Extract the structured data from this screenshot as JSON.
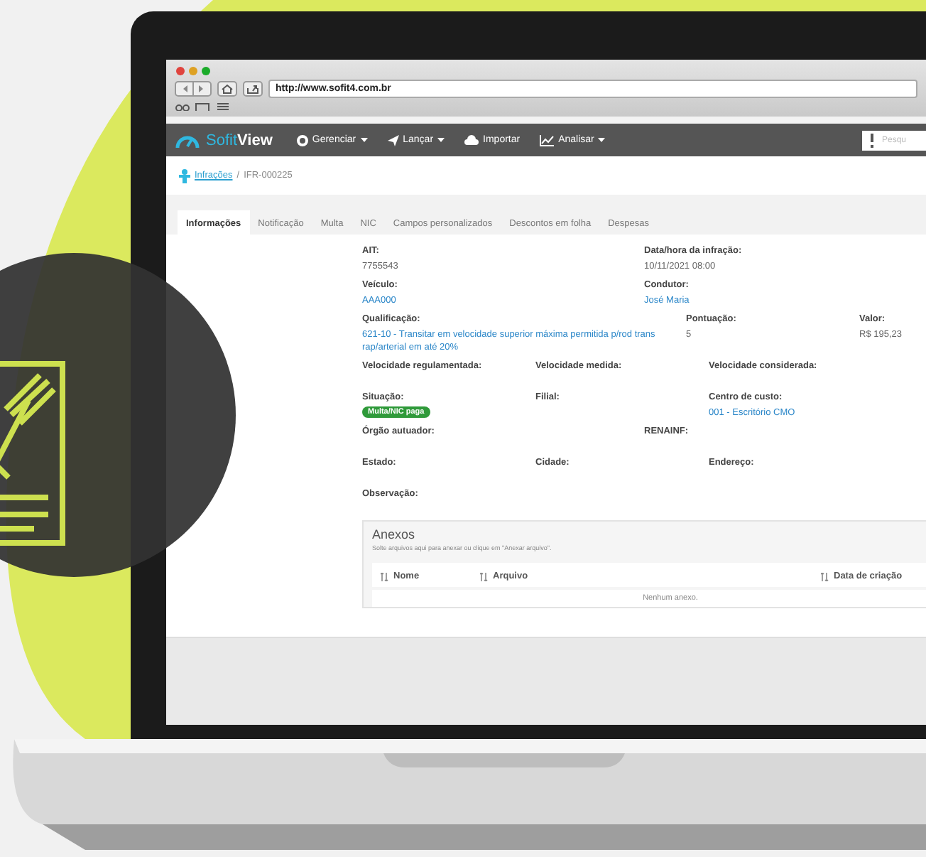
{
  "browser": {
    "url": "http://www.sofit4.com.br"
  },
  "navbar": {
    "logo": {
      "first": "Sofit",
      "second": "View"
    },
    "menu": [
      {
        "label": "Gerenciar",
        "kind": "gear",
        "dropdown": true
      },
      {
        "label": "Lançar",
        "kind": "plane",
        "dropdown": true
      },
      {
        "label": "Importar",
        "kind": "cloud",
        "dropdown": false
      },
      {
        "label": "Analisar",
        "kind": "chart",
        "dropdown": true
      }
    ],
    "search": {
      "placeholder": "Pesqu"
    }
  },
  "breadcrumb": {
    "link": "Infrações",
    "separator": "/",
    "current": "IFR-000225"
  },
  "tabs": [
    {
      "label": "Informações",
      "selected": true
    },
    {
      "label": "Notificação",
      "selected": false
    },
    {
      "label": "Multa",
      "selected": false
    },
    {
      "label": "NIC",
      "selected": false
    },
    {
      "label": "Campos personalizados",
      "selected": false
    },
    {
      "label": "Descontos em folha",
      "selected": false
    },
    {
      "label": "Despesas",
      "selected": false
    }
  ],
  "rows": [
    {
      "left": [
        {
          "label": "AIT:",
          "value": "7755543",
          "kind": "text"
        }
      ],
      "right": [
        {
          "label": "Data/hora da infração:",
          "value": "10/11/2021 08:00",
          "kind": "text"
        }
      ]
    },
    {
      "left": [
        {
          "label": "Veículo:",
          "value": "AAA000",
          "kind": "link"
        }
      ],
      "right": [
        {
          "label": "Condutor:",
          "value": "José Maria",
          "kind": "link"
        }
      ]
    },
    {
      "left": [
        {
          "label": "Qualificação:",
          "value": "621-10 - Transitar em velocidade superior máxima permitida p/rod trans rap/arterial em até 20%",
          "kind": "link",
          "wide": true
        }
      ],
      "right": [
        {
          "label": "Pontuação:",
          "value": "5",
          "kind": "text"
        },
        {
          "label": "Valor:",
          "value": "R$ 195,23",
          "kind": "text"
        }
      ]
    },
    {
      "left": [
        {
          "label": "Velocidade regulamentada:"
        },
        {
          "label": "Velocidade medida:"
        }
      ],
      "right": [
        {
          "label": "Velocidade considerada:"
        }
      ]
    },
    {
      "left": [
        {
          "label": "Situação:",
          "value": "Multa/NIC paga",
          "kind": "badge"
        },
        {
          "label": "Filial:"
        }
      ],
      "right": [
        {
          "label": "Centro de custo:",
          "value": "001 - Escritório CMO",
          "kind": "link"
        }
      ]
    },
    {
      "left": [
        {
          "label": "Órgão autuador:"
        }
      ],
      "right": [
        {
          "label": "RENAINF:"
        }
      ]
    },
    {
      "left": [
        {
          "label": "Estado:"
        },
        {
          "label": "Cidade:"
        }
      ],
      "right": [
        {
          "label": "Endereço:"
        }
      ]
    },
    {
      "left": [
        {
          "label": "Observação:"
        }
      ],
      "right": []
    }
  ],
  "attachments": {
    "title": "Anexos",
    "hint": "Solte arquivos aqui para anexar ou clique em \"Anexar arquivo\".",
    "columns": [
      "Nome",
      "Arquivo",
      "Data de criação"
    ],
    "empty": "Nenhum anexo."
  }
}
